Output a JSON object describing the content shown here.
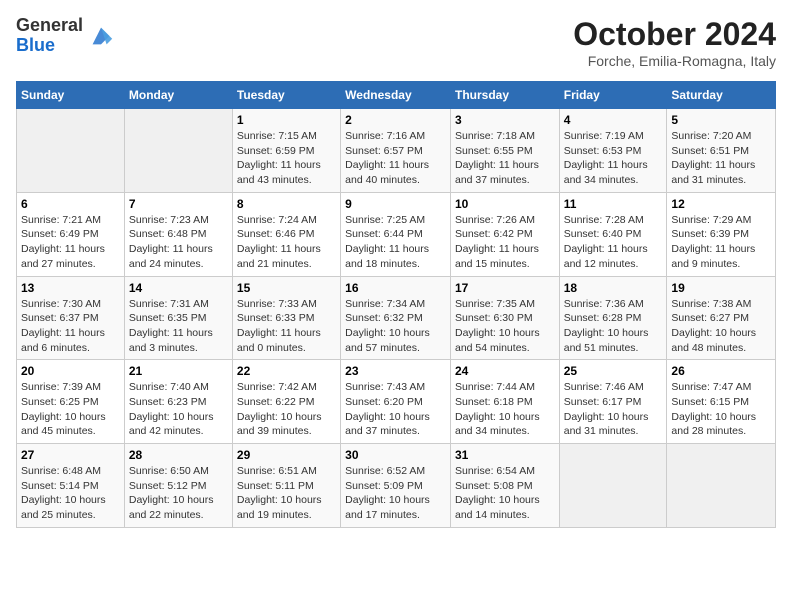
{
  "header": {
    "logo_line1": "General",
    "logo_line2": "Blue",
    "month": "October 2024",
    "location": "Forche, Emilia-Romagna, Italy"
  },
  "weekdays": [
    "Sunday",
    "Monday",
    "Tuesday",
    "Wednesday",
    "Thursday",
    "Friday",
    "Saturday"
  ],
  "weeks": [
    [
      {
        "day": "",
        "info": ""
      },
      {
        "day": "",
        "info": ""
      },
      {
        "day": "1",
        "info": "Sunrise: 7:15 AM\nSunset: 6:59 PM\nDaylight: 11 hours and 43 minutes."
      },
      {
        "day": "2",
        "info": "Sunrise: 7:16 AM\nSunset: 6:57 PM\nDaylight: 11 hours and 40 minutes."
      },
      {
        "day": "3",
        "info": "Sunrise: 7:18 AM\nSunset: 6:55 PM\nDaylight: 11 hours and 37 minutes."
      },
      {
        "day": "4",
        "info": "Sunrise: 7:19 AM\nSunset: 6:53 PM\nDaylight: 11 hours and 34 minutes."
      },
      {
        "day": "5",
        "info": "Sunrise: 7:20 AM\nSunset: 6:51 PM\nDaylight: 11 hours and 31 minutes."
      }
    ],
    [
      {
        "day": "6",
        "info": "Sunrise: 7:21 AM\nSunset: 6:49 PM\nDaylight: 11 hours and 27 minutes."
      },
      {
        "day": "7",
        "info": "Sunrise: 7:23 AM\nSunset: 6:48 PM\nDaylight: 11 hours and 24 minutes."
      },
      {
        "day": "8",
        "info": "Sunrise: 7:24 AM\nSunset: 6:46 PM\nDaylight: 11 hours and 21 minutes."
      },
      {
        "day": "9",
        "info": "Sunrise: 7:25 AM\nSunset: 6:44 PM\nDaylight: 11 hours and 18 minutes."
      },
      {
        "day": "10",
        "info": "Sunrise: 7:26 AM\nSunset: 6:42 PM\nDaylight: 11 hours and 15 minutes."
      },
      {
        "day": "11",
        "info": "Sunrise: 7:28 AM\nSunset: 6:40 PM\nDaylight: 11 hours and 12 minutes."
      },
      {
        "day": "12",
        "info": "Sunrise: 7:29 AM\nSunset: 6:39 PM\nDaylight: 11 hours and 9 minutes."
      }
    ],
    [
      {
        "day": "13",
        "info": "Sunrise: 7:30 AM\nSunset: 6:37 PM\nDaylight: 11 hours and 6 minutes."
      },
      {
        "day": "14",
        "info": "Sunrise: 7:31 AM\nSunset: 6:35 PM\nDaylight: 11 hours and 3 minutes."
      },
      {
        "day": "15",
        "info": "Sunrise: 7:33 AM\nSunset: 6:33 PM\nDaylight: 11 hours and 0 minutes."
      },
      {
        "day": "16",
        "info": "Sunrise: 7:34 AM\nSunset: 6:32 PM\nDaylight: 10 hours and 57 minutes."
      },
      {
        "day": "17",
        "info": "Sunrise: 7:35 AM\nSunset: 6:30 PM\nDaylight: 10 hours and 54 minutes."
      },
      {
        "day": "18",
        "info": "Sunrise: 7:36 AM\nSunset: 6:28 PM\nDaylight: 10 hours and 51 minutes."
      },
      {
        "day": "19",
        "info": "Sunrise: 7:38 AM\nSunset: 6:27 PM\nDaylight: 10 hours and 48 minutes."
      }
    ],
    [
      {
        "day": "20",
        "info": "Sunrise: 7:39 AM\nSunset: 6:25 PM\nDaylight: 10 hours and 45 minutes."
      },
      {
        "day": "21",
        "info": "Sunrise: 7:40 AM\nSunset: 6:23 PM\nDaylight: 10 hours and 42 minutes."
      },
      {
        "day": "22",
        "info": "Sunrise: 7:42 AM\nSunset: 6:22 PM\nDaylight: 10 hours and 39 minutes."
      },
      {
        "day": "23",
        "info": "Sunrise: 7:43 AM\nSunset: 6:20 PM\nDaylight: 10 hours and 37 minutes."
      },
      {
        "day": "24",
        "info": "Sunrise: 7:44 AM\nSunset: 6:18 PM\nDaylight: 10 hours and 34 minutes."
      },
      {
        "day": "25",
        "info": "Sunrise: 7:46 AM\nSunset: 6:17 PM\nDaylight: 10 hours and 31 minutes."
      },
      {
        "day": "26",
        "info": "Sunrise: 7:47 AM\nSunset: 6:15 PM\nDaylight: 10 hours and 28 minutes."
      }
    ],
    [
      {
        "day": "27",
        "info": "Sunrise: 6:48 AM\nSunset: 5:14 PM\nDaylight: 10 hours and 25 minutes."
      },
      {
        "day": "28",
        "info": "Sunrise: 6:50 AM\nSunset: 5:12 PM\nDaylight: 10 hours and 22 minutes."
      },
      {
        "day": "29",
        "info": "Sunrise: 6:51 AM\nSunset: 5:11 PM\nDaylight: 10 hours and 19 minutes."
      },
      {
        "day": "30",
        "info": "Sunrise: 6:52 AM\nSunset: 5:09 PM\nDaylight: 10 hours and 17 minutes."
      },
      {
        "day": "31",
        "info": "Sunrise: 6:54 AM\nSunset: 5:08 PM\nDaylight: 10 hours and 14 minutes."
      },
      {
        "day": "",
        "info": ""
      },
      {
        "day": "",
        "info": ""
      }
    ]
  ]
}
